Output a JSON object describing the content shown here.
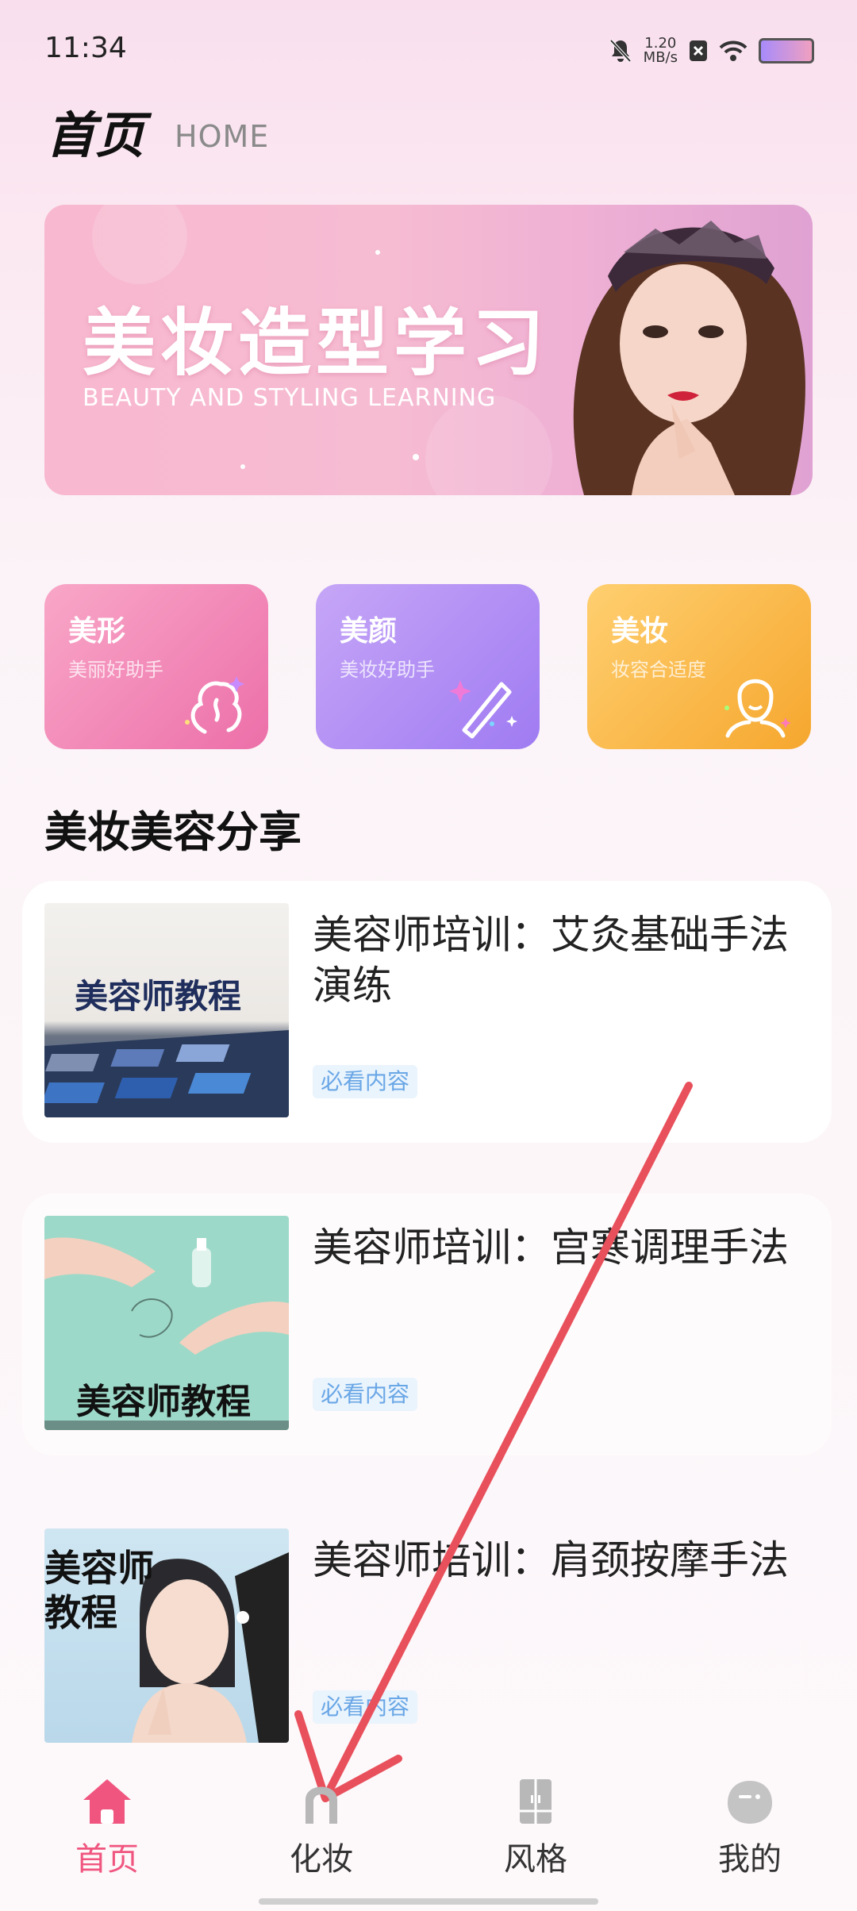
{
  "status_bar": {
    "time": "11:34",
    "speed_value": "1.20",
    "speed_unit": "MB/s"
  },
  "header": {
    "title": "首页",
    "subtitle": "HOME"
  },
  "banner": {
    "title": "美妆造型学习",
    "subtitle": "BEAUTY AND STYLING LEARNING"
  },
  "categories": [
    {
      "name": "美形",
      "desc": "美丽好助手",
      "icon": "hair-profile-icon",
      "color": "#ec6fa9"
    },
    {
      "name": "美颜",
      "desc": "美妆好助手",
      "icon": "magic-wand-icon",
      "color": "#9f7bf2"
    },
    {
      "name": "美妆",
      "desc": "妆容合适度",
      "icon": "face-outline-icon",
      "color": "#f6a72e"
    }
  ],
  "section_title": "美妆美容分享",
  "articles": [
    {
      "title": "美容师培训：艾灸基础手法演练",
      "tag": "必看内容",
      "thumb_label": "美容师教程"
    },
    {
      "title": "美容师培训：宫寒调理手法",
      "tag": "必看内容",
      "thumb_label": "美容师教程"
    },
    {
      "title": "美容师培训：肩颈按摩手法",
      "tag": "必看内容",
      "thumb_label_line1": "美容师",
      "thumb_label_line2": "教程"
    }
  ],
  "nav": [
    {
      "label": "首页",
      "icon": "home-icon",
      "active": true
    },
    {
      "label": "化妆",
      "icon": "makeup-icon",
      "active": false
    },
    {
      "label": "风格",
      "icon": "wardrobe-icon",
      "active": false
    },
    {
      "label": "我的",
      "icon": "profile-icon",
      "active": false
    }
  ],
  "colors": {
    "accent": "#f0557f",
    "tag_text": "#6aa7e6",
    "arrow": "#e8505b"
  }
}
